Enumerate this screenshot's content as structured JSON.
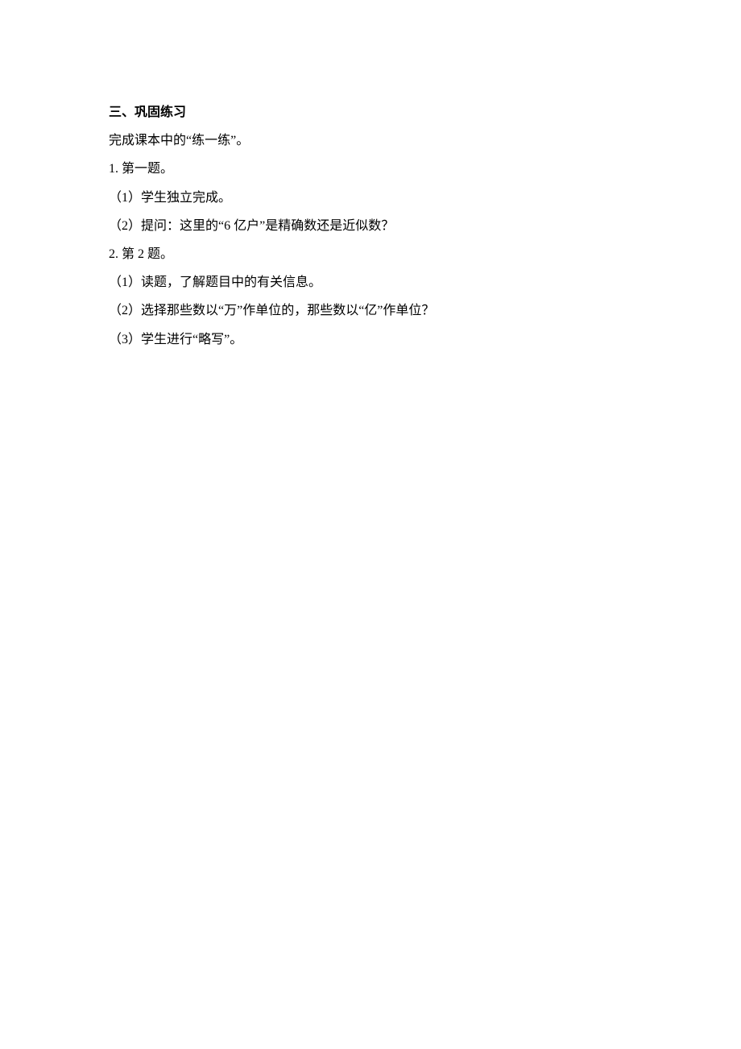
{
  "heading": "三、巩固练习",
  "lines": [
    "完成课本中的“练一练”。",
    "1. 第一题。",
    "（1）学生独立完成。",
    "（2）提问：这里的“6 亿户”是精确数还是近似数？",
    "2. 第 2 题。",
    "（1）读题，了解题目中的有关信息。",
    "（2）选择那些数以“万”作单位的，那些数以“亿”作单位？",
    "（3）学生进行“略写”。"
  ]
}
